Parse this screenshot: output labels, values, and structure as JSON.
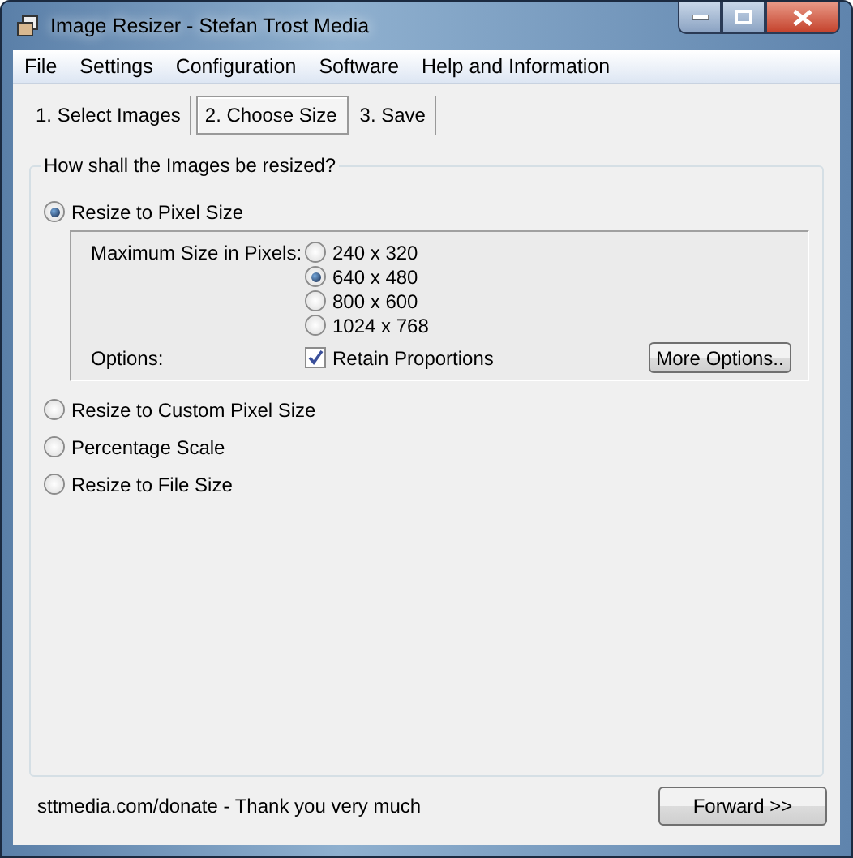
{
  "window": {
    "title": "Image Resizer - Stefan Trost Media"
  },
  "menu": [
    "File",
    "Settings",
    "Configuration",
    "Software",
    "Help and Information"
  ],
  "tabs": [
    {
      "label": "1. Select Images",
      "selected": false
    },
    {
      "label": "2. Choose Size",
      "selected": true
    },
    {
      "label": "3. Save",
      "selected": false
    }
  ],
  "group": {
    "title": "How shall the Images be resized?",
    "modes": [
      {
        "label": "Resize to Pixel Size",
        "selected": true
      },
      {
        "label": "Resize to Custom Pixel Size",
        "selected": false
      },
      {
        "label": "Percentage Scale",
        "selected": false
      },
      {
        "label": "Resize to File Size",
        "selected": false
      }
    ],
    "pixel_panel": {
      "size_label": "Maximum Size in Pixels:",
      "sizes": [
        {
          "label": "240 x 320",
          "selected": false
        },
        {
          "label": "640 x 480",
          "selected": true
        },
        {
          "label": "800 x 600",
          "selected": false
        },
        {
          "label": "1024 x 768",
          "selected": false
        }
      ],
      "options_label": "Options:",
      "retain": {
        "label": "Retain Proportions",
        "checked": true
      },
      "more_button": "More Options.."
    }
  },
  "footer": {
    "text": "sttmedia.com/donate - Thank you very much",
    "button": "Forward >>"
  }
}
